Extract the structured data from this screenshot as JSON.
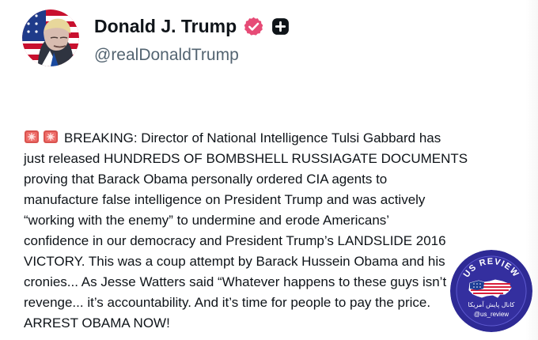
{
  "profile": {
    "display_name": "Donald J. Trump",
    "handle": "@realDonaldTrump",
    "avatar_icon": "flag-portrait-avatar",
    "verified_icon": "verified-badge-icon",
    "plus_icon": "plus-badge-icon"
  },
  "post": {
    "alert_icons": [
      "rotating-light-icon",
      "rotating-light-icon"
    ],
    "lines": [
      "BREAKING: Director of National Intelligence Tulsi Gabbard has",
      "just released HUNDREDS OF BOMBSHELL RUSSIAGATE DOCUMENTS",
      "proving that Barack Obama personally ordered CIA agents to",
      "manufacture false intelligence on President Trump and was actively",
      "“working with the enemy” to undermine and erode Americans’",
      "confidence in our democracy and President Trump’s LANDSLIDE 2016",
      "VICTORY. This was a coup attempt by Barack Hussein Obama and his",
      "cronies... As Jesse Watters said “Whatever happens to these guys isn’t",
      "revenge... it’s accountability. And it’s time for people to pay the price.",
      "ARREST OBAMA NOW!"
    ]
  },
  "watermark": {
    "title": "US REVIEW",
    "subtitle_persian": "کانال پایش آمریکا",
    "handle": "@us_review"
  },
  "colors": {
    "verified": "#e64b76",
    "text": "#0f1419",
    "secondary": "#536471",
    "watermark_bg": "#2e2a95"
  }
}
